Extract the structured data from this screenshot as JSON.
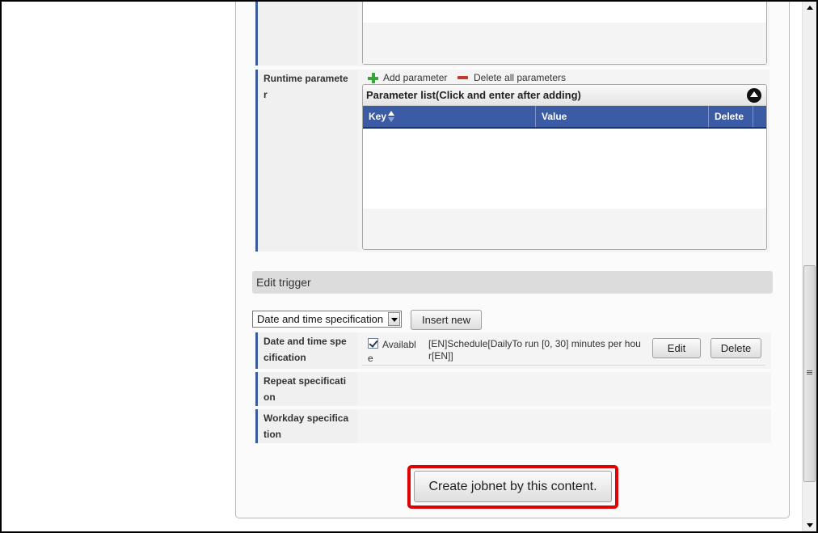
{
  "runtime_parameter": {
    "label": "Runtime parameter",
    "add_label": "Add parameter",
    "delete_all_label": "Delete all parameters",
    "list_title": "Parameter list(Click and enter after adding)",
    "columns": [
      {
        "label": "Key"
      },
      {
        "label": "Value"
      },
      {
        "label": "Delete"
      }
    ],
    "header_color": "#3b5ba5"
  },
  "edit_trigger": {
    "section_title": "Edit trigger",
    "select_value": "Date and time specification",
    "insert_label": "Insert new",
    "rows": [
      {
        "label": "Date and time specification",
        "checkbox_label": "Available",
        "checked": true,
        "description": "[EN]Schedule[DailyTo run [0, 30] minutes per hour[EN]]",
        "edit_label": "Edit",
        "delete_label": "Delete"
      },
      {
        "label": "Repeat specification"
      },
      {
        "label": "Workday specification"
      }
    ]
  },
  "create_button": {
    "label": "Create jobnet by this content.",
    "highlight_color": "#e00000"
  },
  "colors": {
    "label_accent": "#3b5b9a",
    "row_bg": "#f4f4f4"
  }
}
